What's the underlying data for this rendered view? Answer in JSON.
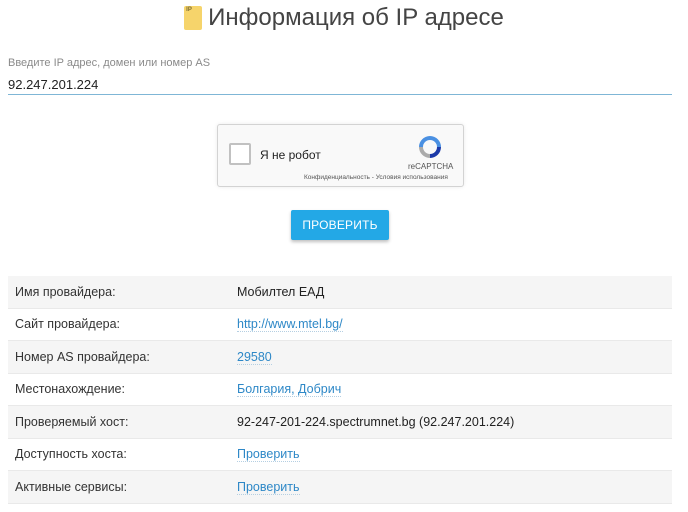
{
  "page": {
    "title": "Информация об IP адресе",
    "title_icon": "document-ip-icon"
  },
  "search": {
    "label": "Введите IP адрес, домен или номер AS",
    "value": "92.247.201.224"
  },
  "captcha": {
    "label": "Я не робот",
    "brand": "reCAPTCHA",
    "links": "Конфиденциальность - Условия использования"
  },
  "check_button": {
    "label": "ПРОВЕРИТЬ"
  },
  "colors": {
    "accent": "#23a8e6",
    "link": "#2e88c7"
  },
  "info": [
    {
      "key": "Имя провайдера:",
      "value": "Мобилтел ЕАД",
      "link": false
    },
    {
      "key": "Сайт провайдера:",
      "value": "http://www.mtel.bg/",
      "link": true
    },
    {
      "key": "Номер AS провайдера:",
      "value": "29580",
      "link": true
    },
    {
      "key": "Местонахождение:",
      "value": "Болгария, Добрич",
      "link": true
    },
    {
      "key": "Проверяемый хост:",
      "value": "92-247-201-224.spectrumnet.bg (92.247.201.224)",
      "link": false
    },
    {
      "key": "Доступность хоста:",
      "value": "Проверить",
      "link": true
    },
    {
      "key": "Активные сервисы:",
      "value": "Проверить",
      "link": true
    }
  ]
}
